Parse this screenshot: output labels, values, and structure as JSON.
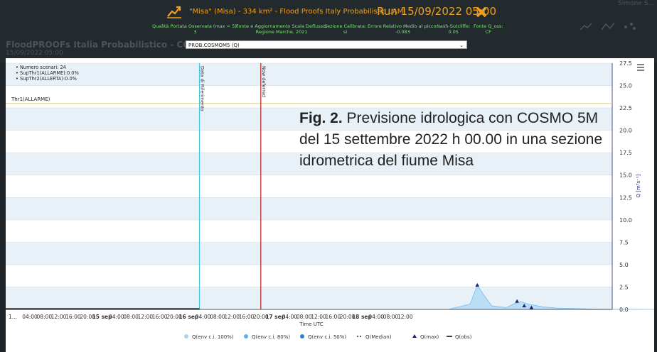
{
  "background": {
    "title": "FloodPROOFs Italia Probabilistico - COSMO...",
    "subtitle": "15/09/2022 05:00",
    "user_label": "Simone S..."
  },
  "header": {
    "title": "\"Misa\" (Misa) - 334 km² - Flood Proofs Italy Probabilistic LAMI",
    "run": "Run 15/09/2022 05:00",
    "accent_color": "#f0a020",
    "stats_color": "#7fe07a",
    "stats": [
      {
        "label": "Qualità Portata Osservata (max = 5):",
        "value": "3"
      },
      {
        "label": "Fonte e Aggiornamento Scala Deflusso:",
        "value": "Regione Marche, 2021"
      },
      {
        "label": "Sezione Calibrata:",
        "value": "si"
      },
      {
        "label": "Errore Relativo Medio al picco:",
        "value": "-0.083"
      },
      {
        "label": "Nash-Sutcliffe:",
        "value": "0.05"
      },
      {
        "label": "Fonte Q_oss:",
        "value": "CF"
      }
    ]
  },
  "select": {
    "value": "PROB.COSMOM5 (Q)"
  },
  "caption": {
    "fig": "Fig. 2.",
    "text": "Previsione idrologica con COSMO 5M del 15 settembre 2022 h 00.00 in una sezione idrometrica del fiume Misa"
  },
  "chart_data": {
    "type": "area",
    "x_start_label": "1...",
    "xlabel": "Time UTC",
    "ylabel": "Q [m³s⁻¹]",
    "ylim": [
      0,
      27.5
    ],
    "yticks": [
      "0.0",
      "2.5",
      "5.0",
      "7.5",
      "10.0",
      "12.5",
      "15.0",
      "17.5",
      "20.0",
      "22.5",
      "25.0",
      "27.5"
    ],
    "xticks": [
      "04:00",
      "08:00",
      "12:00",
      "16:00",
      "20:00",
      "15 sep",
      "04:00",
      "08:00",
      "12:00",
      "16:00",
      "20:00",
      "16 sep",
      "04:00",
      "08:00",
      "12:00",
      "16:00",
      "20:00",
      "17 sep",
      "04:00",
      "08:00",
      "12:00",
      "16:00",
      "20:00",
      "18 sep",
      "04:00",
      "08:00",
      "12:00"
    ],
    "info_box": [
      "Numero scenari: 24",
      "SupThr1(ALLARME):0.0%",
      "SupThr2(ALLERTA):0.0%"
    ],
    "thresholds": [
      {
        "label": "Thr1(ALLARME)",
        "value": 23,
        "color": "#f3e04a"
      }
    ],
    "vlines": [
      {
        "label": "Data di Riferimento",
        "x_hours": 51,
        "color": "#40c8e0"
      },
      {
        "label": "Now deferred",
        "x_hours": 68,
        "color": "#b02020"
      }
    ],
    "legend": [
      {
        "name": "Q(env c.i. 100%)",
        "color": "#a8d4f5",
        "symbol": "dot"
      },
      {
        "name": "Q(env c.i. 80%)",
        "color": "#5bb0ee",
        "symbol": "dot"
      },
      {
        "name": "Q(env c.i. 50%)",
        "color": "#2f7fd0",
        "symbol": "dot"
      },
      {
        "name": "Q(Median)",
        "color": "#222222",
        "symbol": "dash"
      },
      {
        "name": "Q(max)",
        "color": "#1a237e",
        "symbol": "triangle"
      },
      {
        "name": "Q(obs)",
        "color": "#111111",
        "symbol": "line"
      }
    ],
    "series": [
      {
        "name": "Q(env c.i. 100%)",
        "x_hours": [
          0,
          120,
          126,
          128,
          130,
          132,
          136,
          138,
          140,
          142,
          146,
          150,
          160,
          178
        ],
        "values": [
          0,
          0,
          0.6,
          2.7,
          1.5,
          0.4,
          0.2,
          0.6,
          0.9,
          0.6,
          0.3,
          0.15,
          0.05,
          0
        ]
      },
      {
        "name": "Q(max)",
        "x_hours": [
          128,
          139,
          141,
          143
        ],
        "values": [
          2.7,
          0.9,
          0.4,
          0.2
        ]
      },
      {
        "name": "Q(obs)",
        "x_hours": [
          0,
          51
        ],
        "values": [
          0.05,
          0.05
        ]
      }
    ],
    "grid": true
  }
}
